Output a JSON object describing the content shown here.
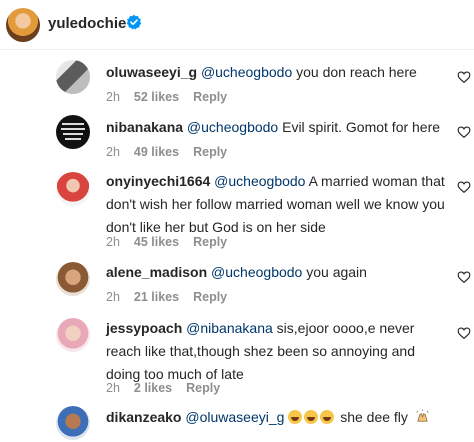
{
  "post": {
    "author": "yuledochie"
  },
  "comments": [
    {
      "username": "oluwaseeyi_g",
      "mention": "@ucheogbodo",
      "text": " you don reach here",
      "time": "2h",
      "likes": "52 likes",
      "reply": "Reply"
    },
    {
      "username": "nibanakana",
      "mention": "@ucheogbodo",
      "text": " Evil spirit. Gomot for here",
      "time": "2h",
      "likes": "49 likes",
      "reply": "Reply"
    },
    {
      "username": "onyinyechi1664",
      "mention": "@ucheogbodo",
      "text": " A married woman that don't wish her follow married woman well we know you don't like her but God is on her side",
      "time": "2h",
      "likes": "45 likes",
      "reply": "Reply"
    },
    {
      "username": "alene_madison",
      "mention": "@ucheogbodo",
      "text": " you again",
      "time": "2h",
      "likes": "21 likes",
      "reply": "Reply"
    },
    {
      "username": "jessypoach",
      "mention": "@nibanakana",
      "text": " sis,ejoor oooo,e never reach like that,though shez been so annoying and doing too much of late",
      "time": "2h",
      "likes": "2 likes",
      "reply": "Reply"
    },
    {
      "username": "dikanzeako",
      "mention": "@oluwaseeyi_g",
      "text": " she dee fly",
      "emoji_count": 3
    }
  ],
  "icons": {
    "verified": "verified-badge-icon",
    "heart": "heart-outline-icon",
    "emoji": "laughing-emoji-icon",
    "hands": "hands-emoji-icon"
  },
  "colors": {
    "text": "#262626",
    "mention": "#00376b",
    "meta": "#8e8e8e",
    "verified": "#0095f6"
  }
}
